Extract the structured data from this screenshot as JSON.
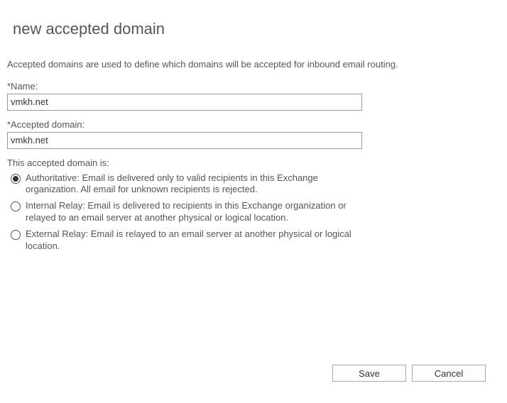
{
  "title": "new accepted domain",
  "description": "Accepted domains are used to define which domains will be accepted for inbound email routing.",
  "fields": {
    "name": {
      "label": "*Name:",
      "value": "vmkh.net"
    },
    "domain": {
      "label": "*Accepted domain:",
      "value": "vmkh.net"
    }
  },
  "radioGroup": {
    "label": "This accepted domain is:",
    "options": [
      {
        "selected": true,
        "text": "Authoritative: Email is delivered only to valid recipients in this Exchange organization. All email for unknown recipients is rejected."
      },
      {
        "selected": false,
        "text": "Internal Relay: Email is delivered to recipients in this Exchange organization or relayed to an email server at another physical or logical location."
      },
      {
        "selected": false,
        "text": "External Relay: Email is relayed to an email server at another physical or logical location."
      }
    ]
  },
  "buttons": {
    "save": "Save",
    "cancel": "Cancel"
  }
}
